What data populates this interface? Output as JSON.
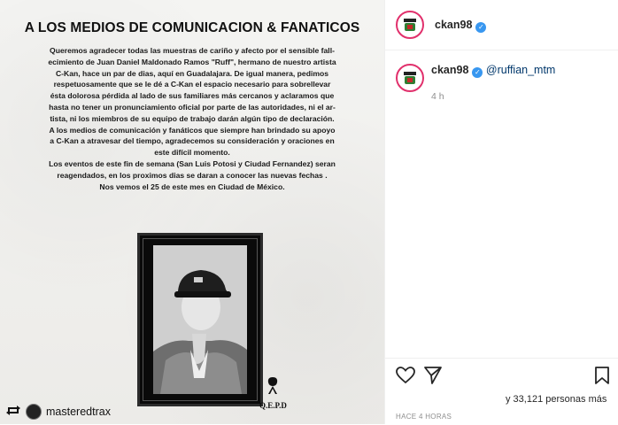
{
  "post": {
    "title": "A LOS MEDIOS DE COMUNICACION & FANATICOS",
    "body": [
      "Queremos agradecer todas las muestras de cariño y afecto por el sensible fall-",
      "ecimiento de Juan Daniel Maldonado Ramos \"Ruff\", hermano de nuestro artista",
      "C-Kan, hace un par de dias, aquí en Guadalajara.  De igual manera, pedimos",
      "respetuosamente que se le dé a C-Kan el espacio necesario para sobrellevar",
      "ésta dolorosa pérdida al lado de sus familiares más cercanos y aclaramos que",
      "hasta no tener un pronunciamiento oficial por parte de las autoridades, ni el ar-",
      "tista, ni los miembros de su equipo de trabajo darán algún tipo de declaración.",
      "A los medios de comunicación y fanáticos que siempre han brindado su apoyo",
      "a C-Kan a atravesar del tiempo, agradecemos su consideración y oraciones en",
      "este difícil momento.",
      "Los eventos de este fin de semana (San Luis Potosi y Ciudad Fernandez) seran",
      "reagendados, en los proximos dias se daran a conocer las nuevas fechas .",
      "Nos vemos el 25 de este mes en Ciudad de México."
    ],
    "qepd": "Q.E.P.D",
    "ribbon_icon": "mourning-ribbon-icon",
    "repost_user": "masteredtrax"
  },
  "header": {
    "username": "ckan98",
    "verified": true
  },
  "comment": {
    "username": "ckan98",
    "mention": "@ruffian_mtm",
    "time": "4 h"
  },
  "footer": {
    "likes": "y 33,121 personas más",
    "posted": "HACE 4 HORAS"
  },
  "colors": {
    "verified": "#3897f0",
    "story_ring": "#e1306c",
    "mention": "#00376b"
  }
}
